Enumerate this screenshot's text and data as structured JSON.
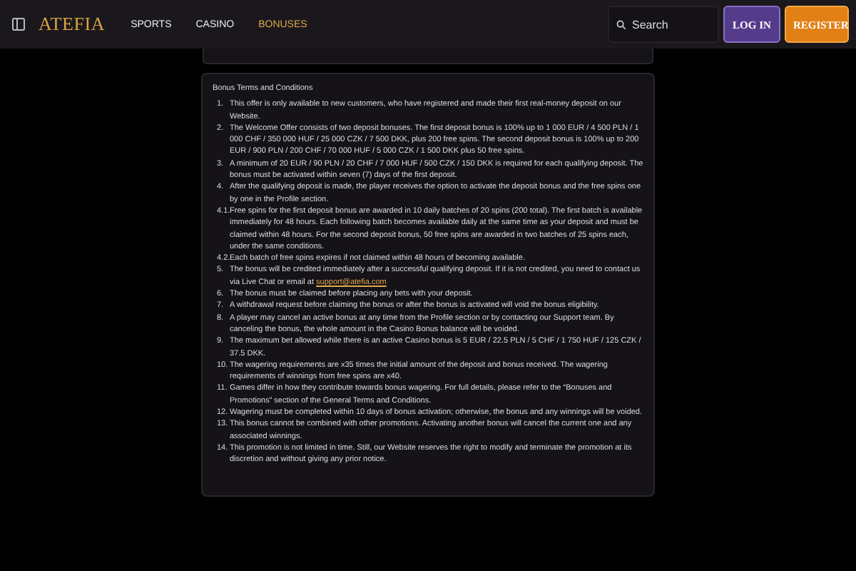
{
  "header": {
    "logo": "ATEFIA",
    "nav": [
      {
        "label": "SPORTS",
        "selected": false
      },
      {
        "label": "CASINO",
        "selected": false
      },
      {
        "label": "BONUSES",
        "selected": true
      }
    ],
    "search": {
      "placeholder": "Search"
    },
    "login": "LOG IN",
    "register": "REGISTER"
  },
  "terms": {
    "title": "Bonus Terms and Conditions",
    "items": [
      {
        "number": "1.",
        "text": "This offer is only available to new customers, who have registered and made their first real-money deposit on our Website."
      },
      {
        "number": "2.",
        "text": "The Welcome Offer consists of two deposit bonuses. The first deposit bonus is 100% up to 1 000 EUR / 4 500 PLN / 1 000 CHF / 350 000 HUF / 25 000 CZK / 7 500 DKK, plus 200 free spins. The second deposit bonus is 100% up to 200 EUR / 900 PLN / 200 CHF / 70 000 HUF / 5 000 CZK / 1 500 DKK plus 50 free spins."
      },
      {
        "number": "3.",
        "text": "A minimum of 20 EUR / 90 PLN / 20 CHF / 7 000 HUF / 500 CZK / 150 DKK is required for each qualifying deposit. The bonus must be activated within seven (7) days of the first deposit."
      },
      {
        "number": "4.",
        "text": "After the qualifying deposit is made, the player receives the option to activate the deposit bonus and the free spins one by one in the Profile section."
      },
      {
        "number": "4.1.",
        "text": "Free spins for the first deposit bonus are awarded in 10 daily batches of 20 spins (200 total). The first batch is available immediately for 48 hours. Each following batch becomes available daily at the same time as your deposit and must be claimed within 48 hours. For the second deposit bonus, 50 free spins are awarded in two batches of 25 spins each, under the same conditions."
      },
      {
        "number": "4.2.",
        "text": "Each batch of free spins expires if not claimed within 48 hours of becoming available."
      },
      {
        "number": "5.",
        "text": "The bonus will be credited immediately after a successful qualifying deposit. If it is not credited, you need to contact us via Live Chat or email at",
        "link": "support@atefia.com"
      },
      {
        "number": "6.",
        "text": "The bonus must be claimed before placing any bets with your deposit."
      },
      {
        "number": "7.",
        "text": "A withdrawal request before claiming the bonus or after the bonus is activated will void the bonus eligibility."
      },
      {
        "number": "8.",
        "text": "A player may cancel an active bonus at any time from the Profile section or by contacting our Support team. By canceling the bonus, the whole amount in the Casino Bonus balance will be voided."
      },
      {
        "number": "9.",
        "text": "The maximum bet allowed while there is an active Casino bonus is 5 EUR / 22.5 PLN / 5 CHF / 1 750 HUF / 125 CZK / 37.5 DKK."
      },
      {
        "number": "10.",
        "text": "The wagering requirements are x35 times the initial amount of the deposit and bonus received. The wagering requirements of winnings from free spins are x40."
      },
      {
        "number": "11.",
        "text": "Games differ in how they contribute towards bonus wagering. For full details, please refer to the “Bonuses and Promotions” section of the General Terms and Conditions."
      },
      {
        "number": "12.",
        "text": "Wagering must be completed within 10 days of bonus activation; otherwise, the bonus and any winnings will be voided."
      },
      {
        "number": "13.",
        "text": "This bonus cannot be combined with other promotions. Activating another bonus will cancel the current one and any associated winnings."
      },
      {
        "number": "14.",
        "text": "This promotion is not limited in time. Still, our Website reserves the right to modify and terminate the promotion at its discretion and without giving any prior notice."
      }
    ]
  }
}
